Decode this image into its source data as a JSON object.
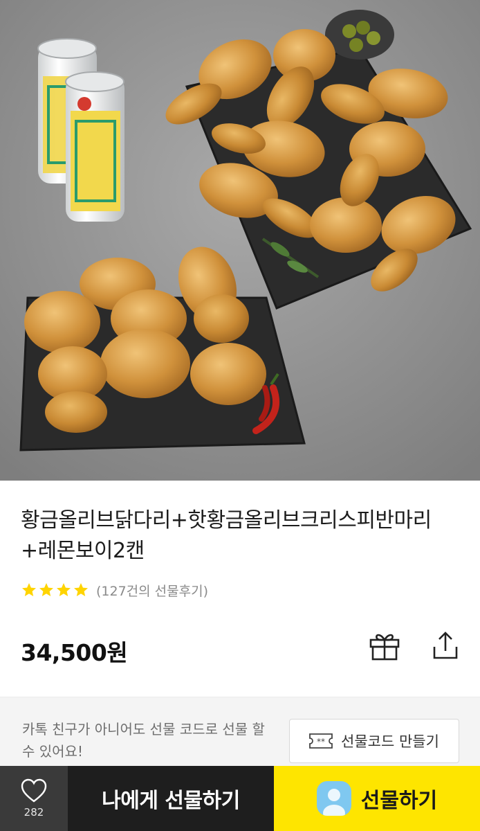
{
  "product": {
    "title": "황금올리브닭다리+핫황금올리브크리스피반마리+레몬보이2캔",
    "rating": 4,
    "review_count_text": "(127건의 선물후기)",
    "price": "34,500원",
    "image_icon": "fried-chicken-photo"
  },
  "actions": {
    "gift_icon": "gift-box-icon",
    "share_icon": "share-upload-icon"
  },
  "gift_code": {
    "description": "카톡 친구가 아니어도 선물 코드로 선물 할 수 있어요!",
    "button_label": "선물코드 만들기",
    "button_icon": "ticket-icon"
  },
  "bottom_bar": {
    "like_count": "282",
    "like_icon": "heart-outline-icon",
    "self_gift_label": "나에게 선물하기",
    "gift_label": "선물하기",
    "gift_icon": "friend-avatar-icon"
  },
  "colors": {
    "accent_yellow": "#fee500",
    "star_yellow": "#ffd400",
    "dark_button": "#1e1e1e",
    "like_button": "#3a3a3a"
  }
}
